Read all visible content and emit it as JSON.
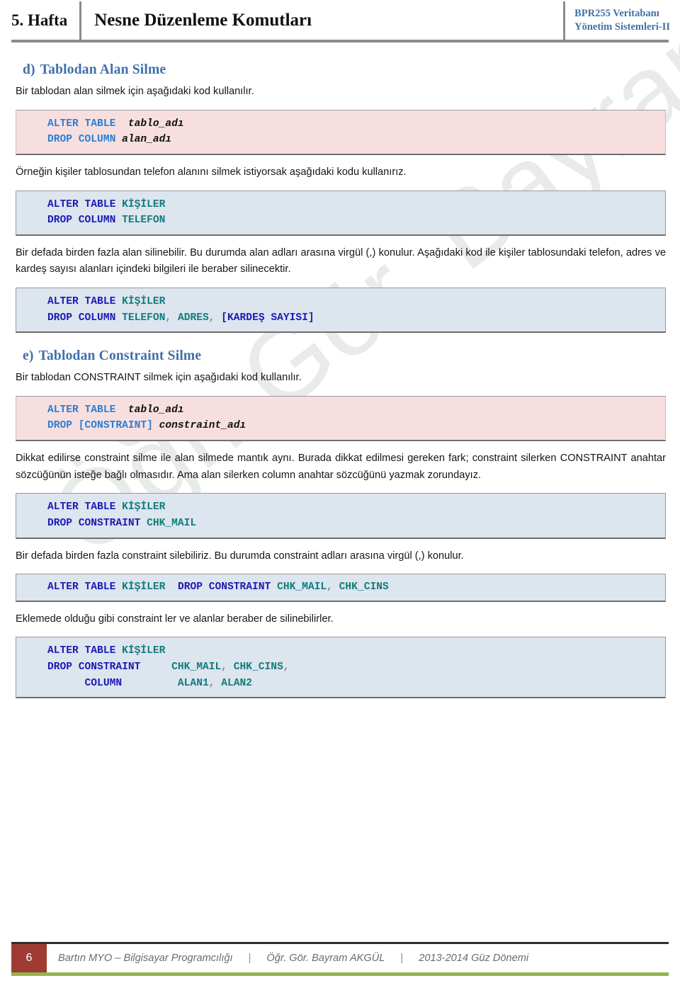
{
  "header": {
    "week": "5. Hafta",
    "title": "Nesne Düzenleme Komutları",
    "course_line1": "BPR255 Veritabanı",
    "course_line2": "Yönetim Sistemleri-II",
    "accent_color": "#4272a6",
    "rule_color": "#8c8c8c"
  },
  "watermark": {
    "text": "Öğr. Gör. Bayram AKGÜL",
    "color": "#e9eaea"
  },
  "sections": {
    "d": {
      "marker": "d)",
      "title": "Tablodan Alan Silme",
      "intro": "Bir tablodan alan silmek için aşağıdaki kod kullanılır.",
      "code1": {
        "style": "pink",
        "line1_kw": "ALTER TABLE",
        "line1_arg": "tablo_adı",
        "line2_kw": "DROP COLUMN",
        "line2_arg": "alan_adı"
      },
      "para_example": "Örneğin kişiler tablosundan telefon alanını silmek istiyorsak aşağıdaki kodu kullanırız.",
      "code2": {
        "style": "blue",
        "line1_kw": "ALTER TABLE",
        "line1_arg": "KİŞİLER",
        "line2_kw": "DROP COLUMN",
        "line2_arg": "TELEFON"
      },
      "para_multi": "Bir defada birden fazla alan silinebilir. Bu durumda alan adları arasına virgül (,) konulur. Aşağıdaki kod ile kişiler tablosundaki telefon, adres ve kardeş sayısı alanları içindeki bilgileri ile beraber silinecektir.",
      "code3": {
        "style": "blue",
        "line1_kw": "ALTER TABLE",
        "line1_arg": "KİŞİLER",
        "line2_kw": "DROP COLUMN",
        "line2_arg1": "TELEFON",
        "line2_arg2": "ADRES",
        "line2_arg3": "[KARDEŞ SAYISI]"
      }
    },
    "e": {
      "marker": "e)",
      "title": "Tablodan Constraint Silme",
      "intro": "Bir tablodan CONSTRAINT silmek için aşağıdaki kod kullanılır.",
      "code1": {
        "style": "pink",
        "line1_kw": "ALTER TABLE",
        "line1_arg": "tablo_adı",
        "line2_kw": "DROP [CONSTRAINT]",
        "line2_arg": "constraint_adı"
      },
      "para_note": "Dikkat edilirse constraint silme ile alan silmede mantık aynı. Burada dikkat edilmesi gereken fark; constraint silerken CONSTRAINT anahtar sözcüğünün isteğe bağlı olmasıdır. Ama alan silerken column anahtar sözcüğünü yazmak zorundayız.",
      "code2": {
        "style": "blue",
        "line1_kw": "ALTER TABLE",
        "line1_arg": "KİŞİLER",
        "line2_kw": "DROP CONSTRAINT",
        "line2_arg": "CHK_MAIL"
      },
      "para_multi": "Bir defada birden fazla constraint silebiliriz. Bu durumda constraint adları arasına virgül (,) konulur.",
      "code3": {
        "style": "blue",
        "kw1": "ALTER TABLE",
        "arg1": "KİŞİLER",
        "kw2": "DROP CONSTRAINT",
        "arg2": "CHK_MAIL",
        "arg3": "CHK_CINS"
      },
      "para_combined": "Eklemede olduğu gibi constraint ler ve alanlar beraber de silinebilirler.",
      "code4": {
        "style": "blue",
        "line1_kw": "ALTER TABLE",
        "line1_arg": "KİŞİLER",
        "line2_kw": "DROP CONSTRAINT",
        "line2_arg1": "CHK_MAIL",
        "line2_arg2": "CHK_CINS",
        "line3_kw": "COLUMN",
        "line3_arg1": "ALAN1",
        "line3_arg2": "ALAN2"
      }
    }
  },
  "footer": {
    "page_number": "6",
    "institution": "Bartın MYO – Bilgisayar Programcılığı",
    "instructor": "Öğr. Gör. Bayram AKGÜL",
    "term": "2013-2014 Güz Dönemi",
    "separator": "|",
    "box_color": "#9e3b32",
    "accent_color": "#93b44f"
  }
}
